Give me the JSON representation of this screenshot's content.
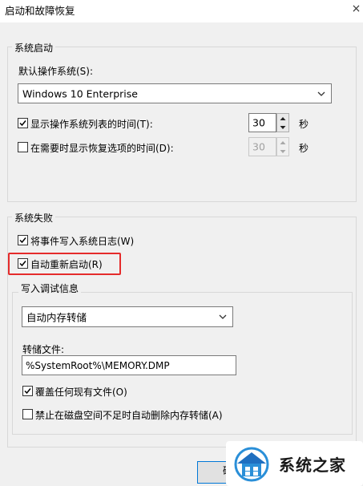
{
  "window": {
    "title": "启动和故障恢复",
    "close_glyph": "×"
  },
  "system_startup": {
    "caption": "系统启动",
    "default_os_label": "默认操作系统(S):",
    "default_os_value": "Windows 10 Enterprise",
    "show_os_list_label": "显示操作系统列表的时间(T):",
    "show_os_list_checked": true,
    "show_os_list_value": "30",
    "show_recovery_label": "在需要时显示恢复选项的时间(D):",
    "show_recovery_checked": false,
    "show_recovery_value": "30",
    "seconds_unit": "秒"
  },
  "system_failure": {
    "caption": "系统失败",
    "write_event_label": "将事件写入系统日志(W)",
    "write_event_checked": true,
    "auto_restart_label": "自动重新启动(R)",
    "auto_restart_checked": true,
    "highlight_color": "#e52b2b"
  },
  "debug_info": {
    "caption": "写入调试信息",
    "dump_type": "自动内存转储",
    "dump_file_label": "转储文件:",
    "dump_file_value": "%SystemRoot%\\MEMORY.DMP",
    "overwrite_label": "覆盖任何现有文件(O)",
    "overwrite_checked": true,
    "disable_auto_delete_label": "禁止在磁盘空间不足时自动删除内存转储(A)",
    "disable_auto_delete_checked": false
  },
  "buttons": {
    "ok_partial": "确"
  },
  "watermark": {
    "text": "系统之家",
    "icon": "house-logo-icon"
  }
}
